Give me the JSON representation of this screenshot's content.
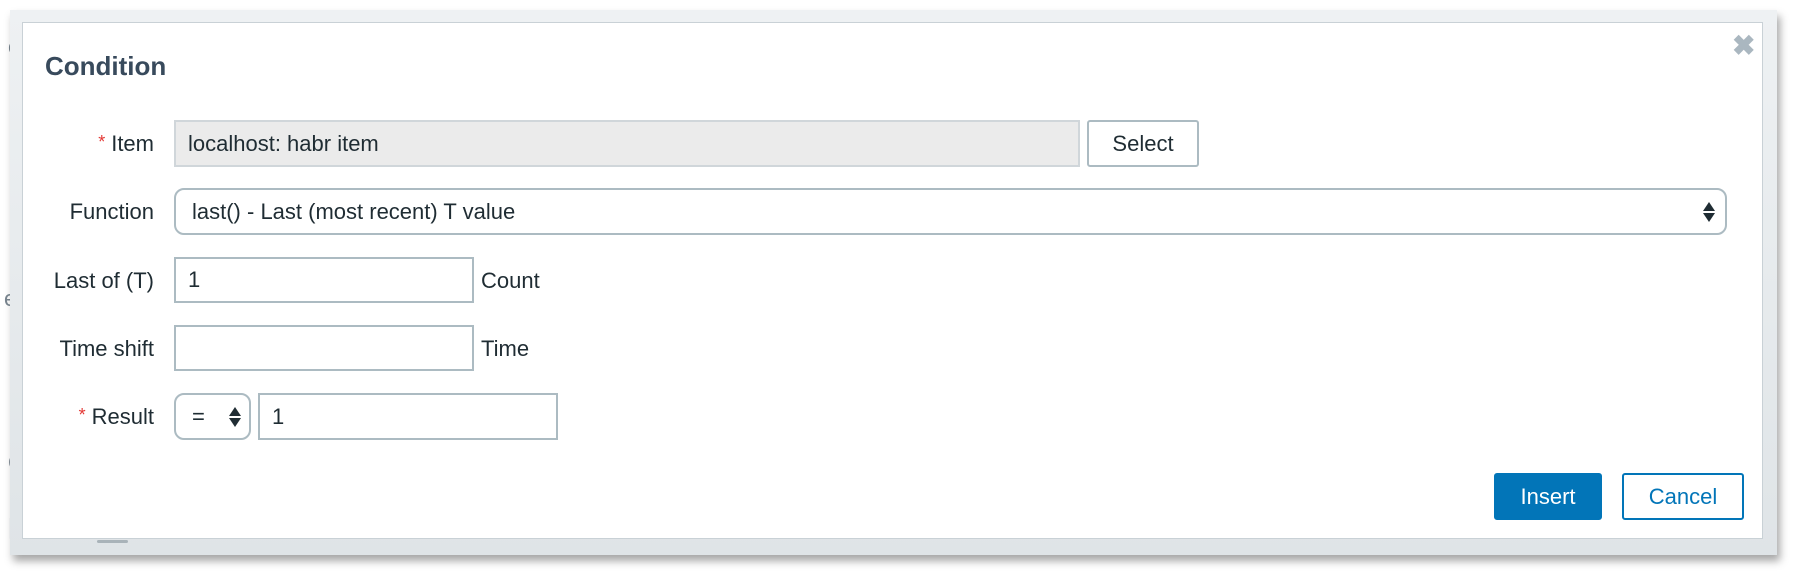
{
  "background_fragments": [
    "e",
    "el",
    "I",
    "C",
    "|"
  ],
  "dialog": {
    "title": "Condition",
    "close_icon": "close-icon",
    "required_marker": "*",
    "fields": {
      "item": {
        "label": "Item",
        "required": true,
        "value": "localhost: habr item",
        "button": "Select"
      },
      "function": {
        "label": "Function",
        "selected": "last() - Last (most recent) T value"
      },
      "last_of": {
        "label": "Last of (T)",
        "value": "1",
        "suffix": "Count"
      },
      "time_shift": {
        "label": "Time shift",
        "value": "",
        "suffix": "Time"
      },
      "result": {
        "label": "Result",
        "required": true,
        "operator": "=",
        "value": "1"
      }
    },
    "buttons": {
      "insert": "Insert",
      "cancel": "Cancel"
    },
    "colors": {
      "accent": "#0275b8",
      "required": "#e33734",
      "title": "#384a5c"
    }
  }
}
